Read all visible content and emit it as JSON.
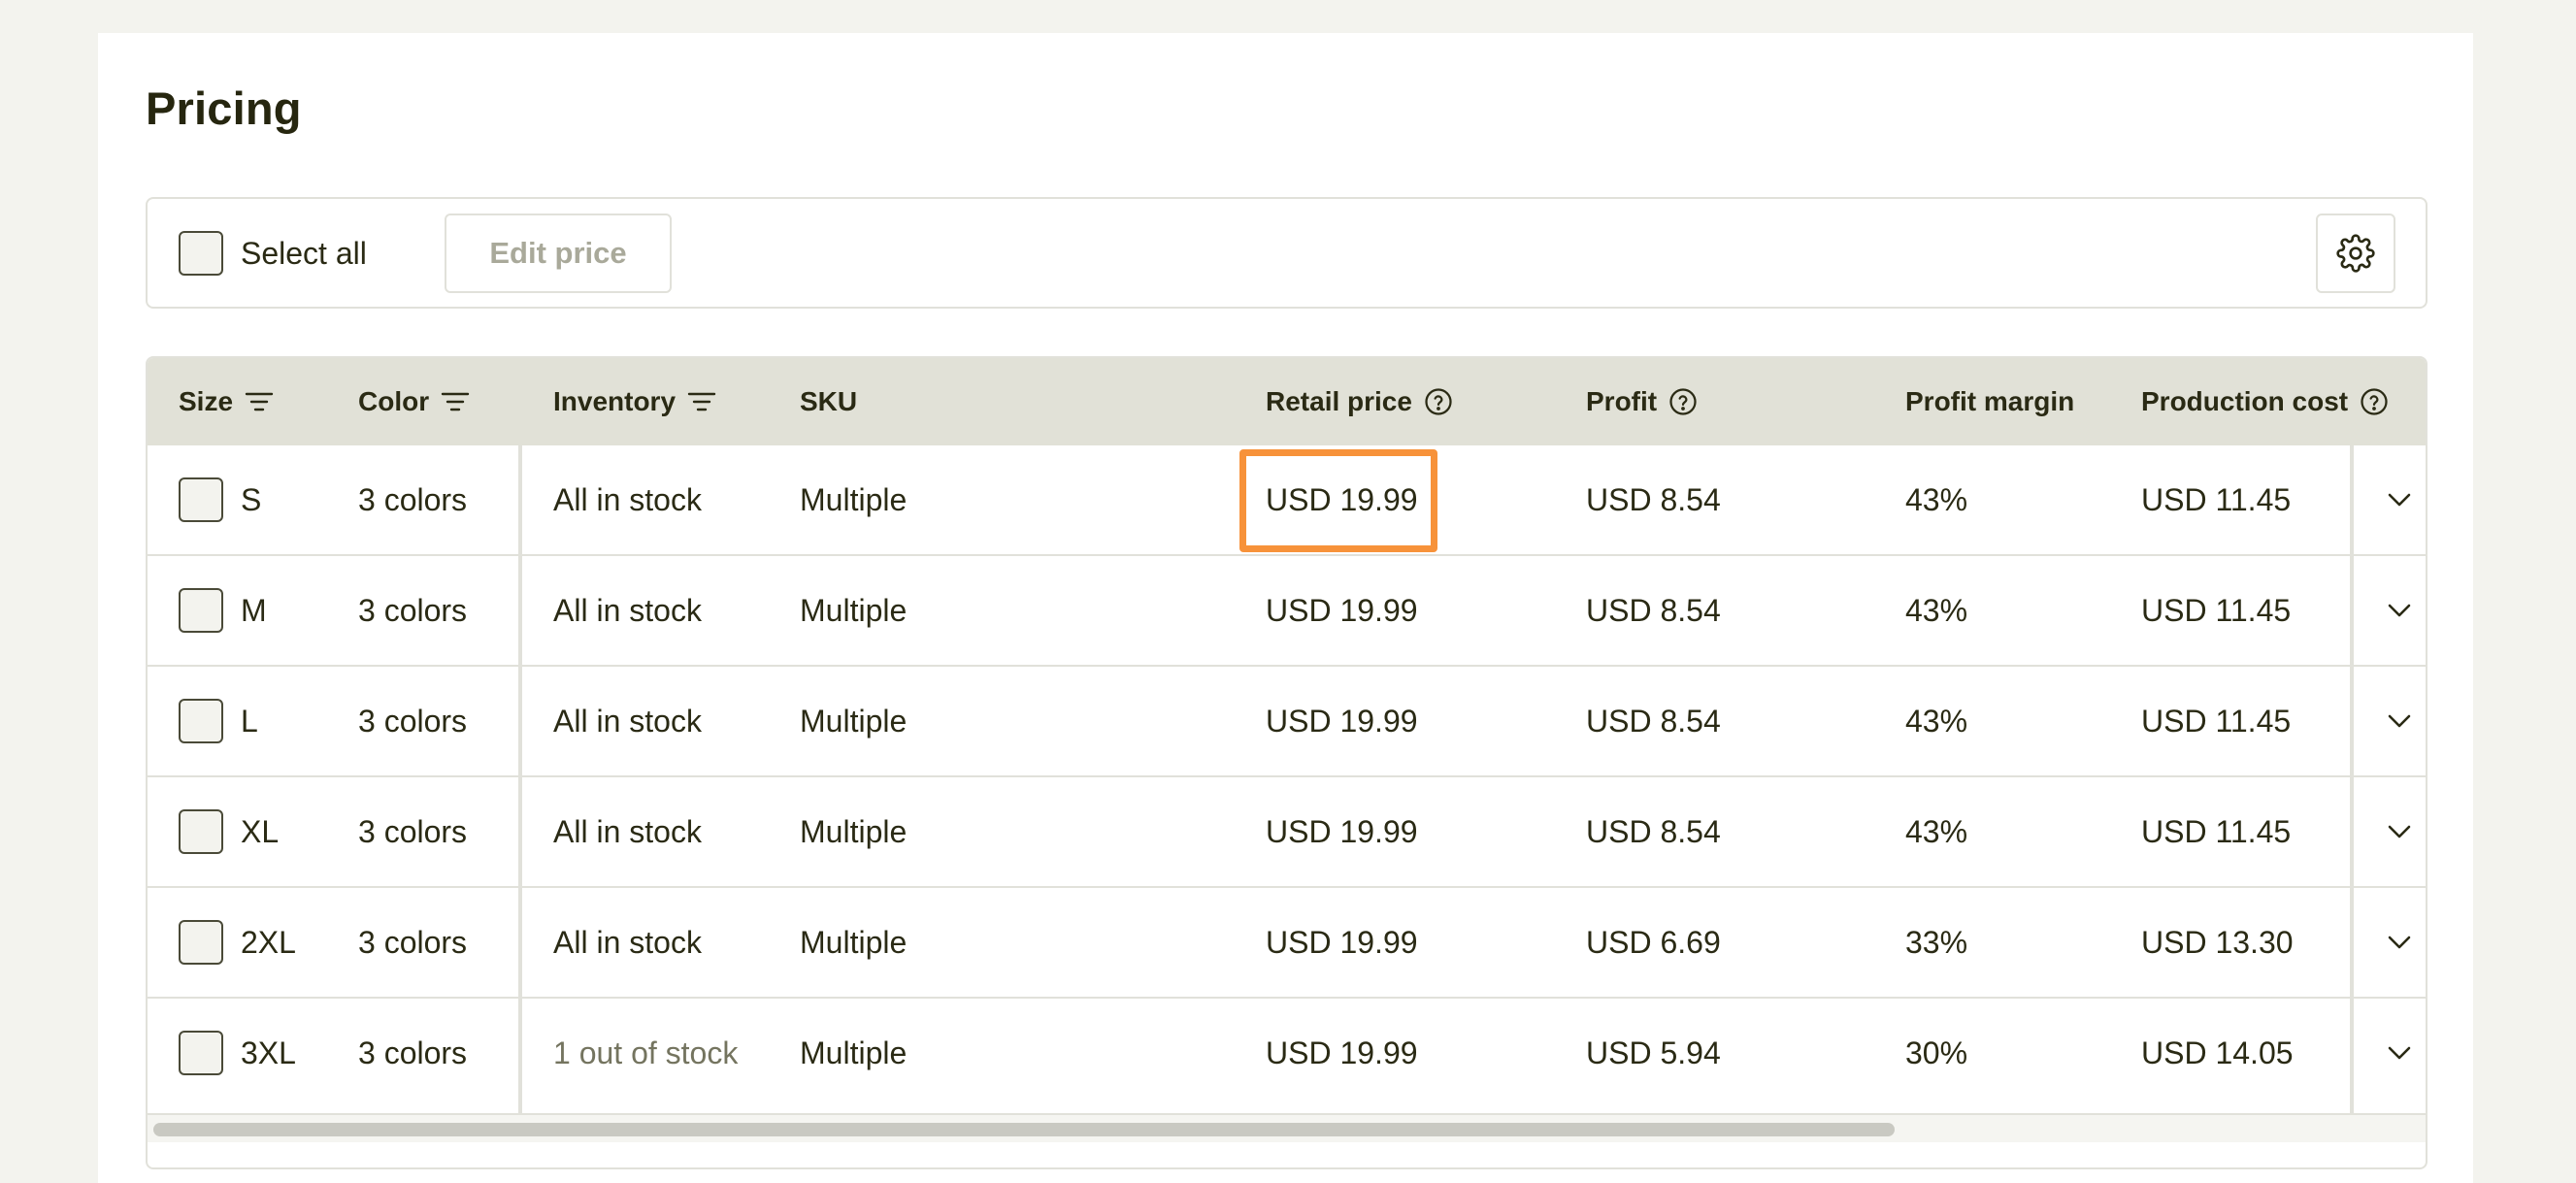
{
  "page": {
    "title": "Pricing"
  },
  "toolbar": {
    "select_all_label": "Select all",
    "edit_price_label": "Edit price",
    "settings_icon": "gear-icon"
  },
  "table": {
    "headers": {
      "size": "Size",
      "color": "Color",
      "inventory": "Inventory",
      "sku": "SKU",
      "retail_price": "Retail price",
      "profit": "Profit",
      "profit_margin": "Profit margin",
      "production_cost": "Production cost"
    },
    "rows": [
      {
        "size": "S",
        "color": "3 colors",
        "inventory": "All in stock",
        "sku": "Multiple",
        "retail_price": "USD 19.99",
        "profit": "USD 8.54",
        "profit_margin": "43%",
        "production_cost": "USD 11.45"
      },
      {
        "size": "M",
        "color": "3 colors",
        "inventory": "All in stock",
        "sku": "Multiple",
        "retail_price": "USD 19.99",
        "profit": "USD 8.54",
        "profit_margin": "43%",
        "production_cost": "USD 11.45"
      },
      {
        "size": "L",
        "color": "3 colors",
        "inventory": "All in stock",
        "sku": "Multiple",
        "retail_price": "USD 19.99",
        "profit": "USD 8.54",
        "profit_margin": "43%",
        "production_cost": "USD 11.45"
      },
      {
        "size": "XL",
        "color": "3 colors",
        "inventory": "All in stock",
        "sku": "Multiple",
        "retail_price": "USD 19.99",
        "profit": "USD 8.54",
        "profit_margin": "43%",
        "production_cost": "USD 11.45"
      },
      {
        "size": "2XL",
        "color": "3 colors",
        "inventory": "All in stock",
        "sku": "Multiple",
        "retail_price": "USD 19.99",
        "profit": "USD 6.69",
        "profit_margin": "33%",
        "production_cost": "USD 13.30"
      },
      {
        "size": "3XL",
        "color": "3 colors",
        "inventory": "1 out of stock",
        "sku": "Multiple",
        "retail_price": "USD 19.99",
        "profit": "USD 5.94",
        "profit_margin": "30%",
        "production_cost": "USD 14.05"
      }
    ]
  },
  "colors": {
    "highlight": "#f7923a",
    "header_bg": "#e1e1d7",
    "page_bg": "#f3f3ee",
    "text": "#2a2a14",
    "muted_text": "#74745f"
  }
}
